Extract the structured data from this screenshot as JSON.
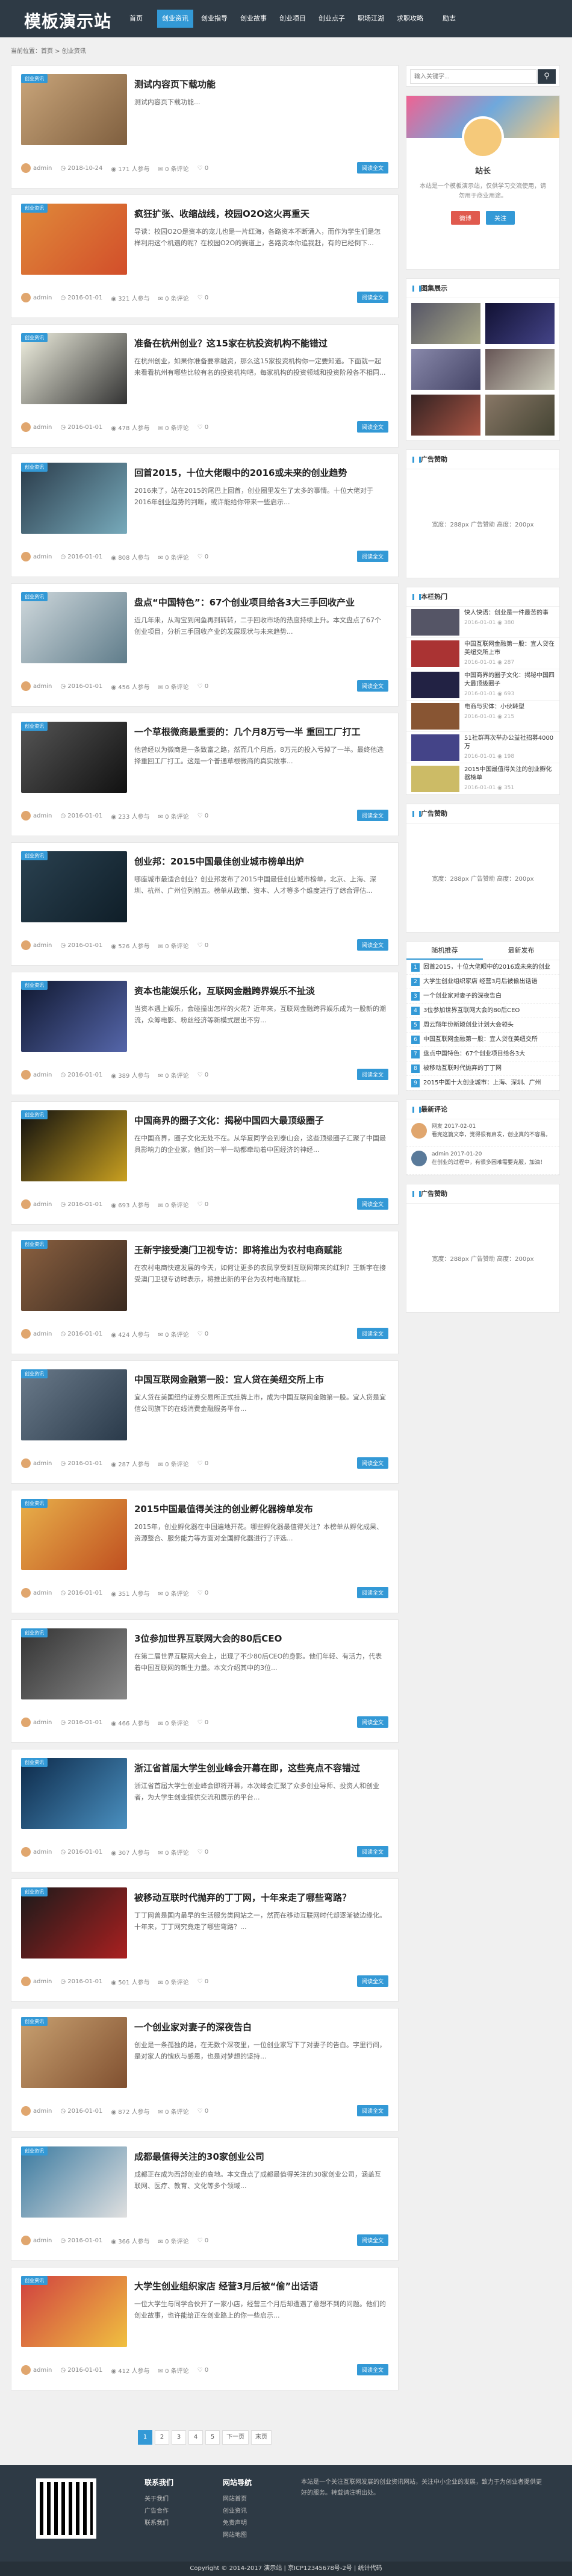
{
  "header": {
    "logo": "模板演示站",
    "nav": [
      "首页",
      "创业资讯",
      "创业指导",
      "创业故事",
      "创业项目",
      "创业点子",
      "职场江湖",
      "求职攻略",
      "励志"
    ]
  },
  "breadcrumb": "当前位置：首页 > 创业资讯",
  "posts": [
    {
      "badge": "创业资讯",
      "title": "测试内容页下载功能",
      "excerpt": "测试内容页下载功能...",
      "author": "admin",
      "date": "2018-10-24",
      "views": "171 人参与",
      "comments": "0 条评论",
      "likes": "0",
      "more": "阅读全文"
    },
    {
      "badge": "创业资讯",
      "title": "疯狂扩张、收缩战线，校园O2O这火再重天",
      "excerpt": "导读：校园O2O是资本的宠儿也是一片红海，各路资本不断涌入，而作为学生们是怎样利用这个机遇的呢？在校园O2O的赛道上，各路资本你追我赶，有的已经倒下...",
      "author": "admin",
      "date": "2016-01-01",
      "views": "321 人参与",
      "comments": "0 条评论",
      "likes": "0",
      "more": "阅读全文"
    },
    {
      "badge": "创业资讯",
      "title": "准备在杭州创业？这15家在杭投资机构不能错过",
      "excerpt": "在杭州创业，如果你准备要拿融资，那么这15家投资机构你一定要知道。下面就一起来看看杭州有哪些比较有名的投资机构吧，每家机构的投资领域和投资阶段各不相同...",
      "author": "admin",
      "date": "2016-01-01",
      "views": "478 人参与",
      "comments": "0 条评论",
      "likes": "0",
      "more": "阅读全文"
    },
    {
      "badge": "创业资讯",
      "title": "回首2015，十位大佬眼中的2016或未来的创业趋势",
      "excerpt": "2016来了，站在2015的尾巴上回首，创业圈里发生了太多的事情。十位大佬对于2016年创业趋势的判断，或许能给你带来一些启示...",
      "author": "admin",
      "date": "2016-01-01",
      "views": "808 人参与",
      "comments": "0 条评论",
      "likes": "0",
      "more": "阅读全文"
    },
    {
      "badge": "创业资讯",
      "title": "盘点“中国特色”：67个创业项目给各3大三手回收产业",
      "excerpt": "近几年来，从淘宝到闲鱼再到转转，二手回收市场的热度持续上升。本文盘点了67个创业项目，分析三手回收产业的发展现状与未来趋势...",
      "author": "admin",
      "date": "2016-01-01",
      "views": "456 人参与",
      "comments": "0 条评论",
      "likes": "0",
      "more": "阅读全文"
    },
    {
      "badge": "创业资讯",
      "title": "一个草根微商最重要的：几个月8万亏一半 重回工厂打工",
      "excerpt": "他曾经以为微商是一条致富之路，然而几个月后，8万元的投入亏掉了一半。最终他选择重回工厂打工。这是一个普通草根微商的真实故事...",
      "author": "admin",
      "date": "2016-01-01",
      "views": "233 人参与",
      "comments": "0 条评论",
      "likes": "0",
      "more": "阅读全文"
    },
    {
      "badge": "创业资讯",
      "title": "创业邦：2015中国最佳创业城市榜单出炉",
      "excerpt": "哪座城市最适合创业？创业邦发布了2015中国最佳创业城市榜单，北京、上海、深圳、杭州、广州位列前五。榜单从政策、资本、人才等多个维度进行了综合评估...",
      "author": "admin",
      "date": "2016-01-01",
      "views": "526 人参与",
      "comments": "0 条评论",
      "likes": "0",
      "more": "阅读全文"
    },
    {
      "badge": "创业资讯",
      "title": "资本也能娱乐化，互联网金融跨界娱乐不扯淡",
      "excerpt": "当资本遇上娱乐，会碰撞出怎样的火花？近年来，互联网金融跨界娱乐成为一股新的潮流，众筹电影、粉丝经济等新模式层出不穷...",
      "author": "admin",
      "date": "2016-01-01",
      "views": "389 人参与",
      "comments": "0 条评论",
      "likes": "0",
      "more": "阅读全文"
    },
    {
      "badge": "创业资讯",
      "title": "中国商界的圈子文化：揭秘中国四大最顶级圈子",
      "excerpt": "在中国商界，圈子文化无处不在。从华夏同学会到泰山会，这些顶级圈子汇聚了中国最具影响力的企业家，他们的一举一动都牵动着中国经济的神经...",
      "author": "admin",
      "date": "2016-01-01",
      "views": "693 人参与",
      "comments": "0 条评论",
      "likes": "0",
      "more": "阅读全文"
    },
    {
      "badge": "创业资讯",
      "title": "王新宇接受澳门卫视专访：即将推出为农村电商赋能",
      "excerpt": "在农村电商快速发展的今天，如何让更多的农民享受到互联网带来的红利？王新宇在接受澳门卫视专访时表示，将推出新的平台为农村电商赋能...",
      "author": "admin",
      "date": "2016-01-01",
      "views": "424 人参与",
      "comments": "0 条评论",
      "likes": "0",
      "more": "阅读全文"
    },
    {
      "badge": "创业资讯",
      "title": "中国互联网金融第一股：宜人贷在美纽交所上市",
      "excerpt": "宜人贷在美国纽约证券交易所正式挂牌上市，成为中国互联网金融第一股。宜人贷是宜信公司旗下的在线消费金融服务平台...",
      "author": "admin",
      "date": "2016-01-01",
      "views": "287 人参与",
      "comments": "0 条评论",
      "likes": "0",
      "more": "阅读全文"
    },
    {
      "badge": "创业资讯",
      "title": "2015中国最值得关注的创业孵化器榜单发布",
      "excerpt": "2015年，创业孵化器在中国遍地开花。哪些孵化器最值得关注？本榜单从孵化成果、资源整合、服务能力等方面对全国孵化器进行了评选...",
      "author": "admin",
      "date": "2016-01-01",
      "views": "351 人参与",
      "comments": "0 条评论",
      "likes": "0",
      "more": "阅读全文"
    },
    {
      "badge": "创业资讯",
      "title": "3位参加世界互联网大会的80后CEO",
      "excerpt": "在第二届世界互联网大会上，出现了不少80后CEO的身影。他们年轻、有活力，代表着中国互联网的新生力量。本文介绍其中的3位...",
      "author": "admin",
      "date": "2016-01-01",
      "views": "466 人参与",
      "comments": "0 条评论",
      "likes": "0",
      "more": "阅读全文"
    },
    {
      "badge": "创业资讯",
      "title": "浙江省首届大学生创业峰会开幕在即，这些亮点不容错过",
      "excerpt": "浙江省首届大学生创业峰会即将开幕，本次峰会汇聚了众多创业导师、投资人和创业者，为大学生创业提供交流和展示的平台...",
      "author": "admin",
      "date": "2016-01-01",
      "views": "307 人参与",
      "comments": "0 条评论",
      "likes": "0",
      "more": "阅读全文"
    },
    {
      "badge": "创业资讯",
      "title": "被移动互联时代抛弃的丁丁网，十年来走了哪些弯路？",
      "excerpt": "丁丁网曾是国内最早的生活服务类网站之一，然而在移动互联网时代却逐渐被边缘化。十年来，丁丁网究竟走了哪些弯路？...",
      "author": "admin",
      "date": "2016-01-01",
      "views": "501 人参与",
      "comments": "0 条评论",
      "likes": "0",
      "more": "阅读全文"
    },
    {
      "badge": "创业资讯",
      "title": "一个创业家对妻子的深夜告白",
      "excerpt": "创业是一条孤独的路，在无数个深夜里，一位创业家写下了对妻子的告白。字里行间，是对家人的愧疚与感恩，也是对梦想的坚持...",
      "author": "admin",
      "date": "2016-01-01",
      "views": "872 人参与",
      "comments": "0 条评论",
      "likes": "0",
      "more": "阅读全文"
    },
    {
      "badge": "创业资讯",
      "title": "成都最值得关注的30家创业公司",
      "excerpt": "成都正在成为西部创业的高地。本文盘点了成都最值得关注的30家创业公司，涵盖互联网、医疗、教育、文化等多个领域...",
      "author": "admin",
      "date": "2016-01-01",
      "views": "366 人参与",
      "comments": "0 条评论",
      "likes": "0",
      "more": "阅读全文"
    },
    {
      "badge": "创业资讯",
      "title": "大学生创业组织家店 经营3月后被“偷”出话语",
      "excerpt": "一位大学生与同学合伙开了一家小店，经营三个月后却遭遇了意想不到的问题。他们的创业故事，也许能给正在创业路上的你一些启示...",
      "author": "admin",
      "date": "2016-01-01",
      "views": "412 人参与",
      "comments": "0 条评论",
      "likes": "0",
      "more": "阅读全文"
    }
  ],
  "pager": [
    "1",
    "2",
    "3",
    "4",
    "5",
    "下一页",
    "末页"
  ],
  "sidebar": {
    "search_placeholder": "输入关键字...",
    "profile": {
      "name": "站长",
      "desc": "本站是一个模板演示站，仅供学习交流使用，请勿用于商业用途。",
      "btn1": "微博",
      "btn2": "关注"
    },
    "photos_title": "图集展示",
    "ad1_title": "广告赞助",
    "ad_text": "宽度：288px  广告赞助  高度：200px",
    "hot_title": "本栏热门",
    "hot": [
      {
        "title": "快人快语：创业是一件最苦的事",
        "date": "2016-01-01",
        "views": "380"
      },
      {
        "title": "中国互联网金融第一股：宜人贷在美纽交所上市",
        "date": "2016-01-01",
        "views": "287"
      },
      {
        "title": "中国商界的圈子文化：揭秘中国四大最顶级圈子",
        "date": "2016-01-01",
        "views": "693"
      },
      {
        "title": "电商与实体：小伙转型",
        "date": "2016-01-01",
        "views": "215"
      },
      {
        "title": "51社群再次举办公益社招募4000万",
        "date": "2016-01-01",
        "views": "198"
      },
      {
        "title": "2015中国最值得关注的创业孵化器榜单",
        "date": "2016-01-01",
        "views": "351"
      }
    ],
    "ad2_title": "广告赞助",
    "tabs": [
      "随机推荐",
      "最新发布"
    ],
    "rank": [
      "回首2015，十位大佬眼中的2016或未来的创业",
      "大学生创业组织家店 经营3月后被偷出话语",
      "一个创业家对妻子的深夜告白",
      "3位参加世界互联网大会的80后CEO",
      "周云翔年份新颖创业计划大会领头",
      "中国互联网金融第一股：宜人贷在美纽交所",
      "盘点中国特色：67个创业项目给各3大",
      "被移动互联时代抛弃的丁丁网",
      "2015中国十大创业城市：上海、深圳、广州"
    ],
    "comments_title": "最新评论",
    "comments": [
      {
        "user": "网友",
        "date": "2017-02-01",
        "text": "看完这篇文章，觉得很有启发，创业真的不容易。"
      },
      {
        "user": "admin",
        "date": "2017-01-20",
        "text": "在创业的过程中，有很多困难需要克服，加油！"
      }
    ],
    "ad3_title": "广告赞助"
  },
  "footer": {
    "col1_title": "联系我们",
    "col1": [
      "关于我们",
      "广告合作",
      "联系我们"
    ],
    "col2_title": "网站导航",
    "col2": [
      "网站首页",
      "创业资讯",
      "免责声明",
      "网站地图"
    ],
    "about": "本站是一个关注互联网发展的创业资讯网站，关注中小企业的发展，致力于为创业者提供更好的服务。转载请注明出处。",
    "copyright": "Copyright © 2014-2017  演示站  |  京ICP12345678号-2号  |  统计代码"
  }
}
